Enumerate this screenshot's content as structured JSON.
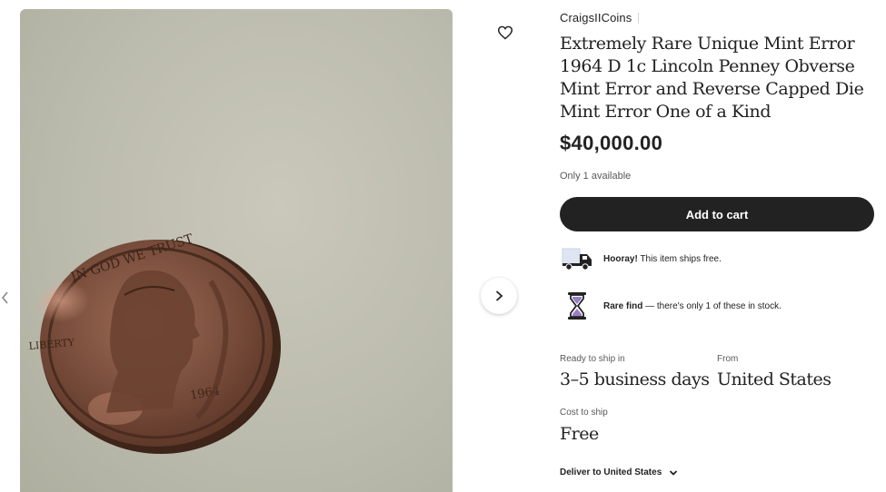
{
  "listing": {
    "shop_name": "CraigsIICoins",
    "title": "Extremely Rare Unique Mint Error 1964 D 1c Lincoln Penney Obverse Mint Error and Reverse Capped Die Mint Error One of a Kind",
    "price": "$40,000.00",
    "availability": "Only 1 available",
    "add_to_cart_label": "Add to cart"
  },
  "perks": {
    "free_shipping": {
      "bold": "Hooray!",
      "text": " This item ships free.",
      "icon": "delivery-truck-icon"
    },
    "rare_find": {
      "bold": "Rare find",
      "text": " — there's only 1 of these in stock.",
      "icon": "hourglass-icon"
    }
  },
  "shipping": {
    "ready_label": "Ready to ship in",
    "ready_value": "3–5 business days",
    "from_label": "From",
    "from_value": "United States",
    "cost_label": "Cost to ship",
    "cost_value": "Free",
    "deliver_to": "Deliver to United States"
  },
  "colors": {
    "button_bg": "#222222",
    "coin_copper": "#8a5a44",
    "hourglass_sand": "#9b7fc4"
  }
}
